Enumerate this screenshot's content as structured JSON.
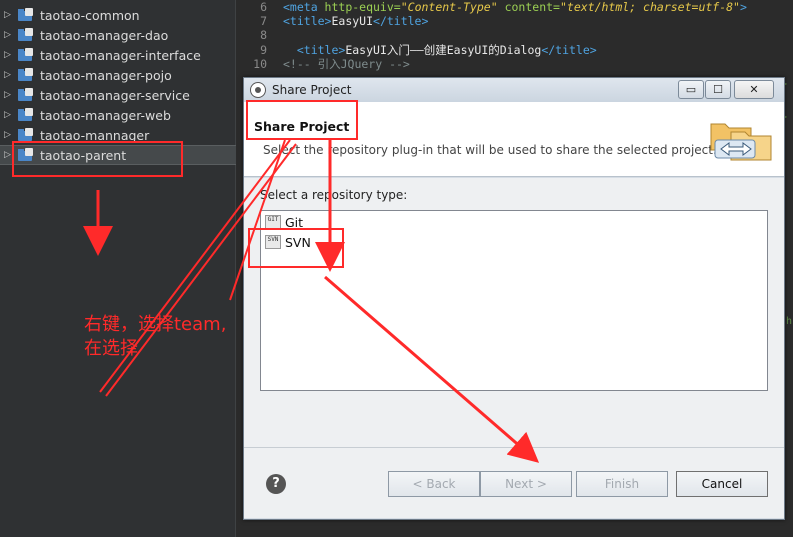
{
  "explorer": {
    "items": [
      {
        "label": "taotao-common",
        "expanded": false
      },
      {
        "label": "taotao-manager-dao",
        "expanded": false
      },
      {
        "label": "taotao-manager-interface",
        "expanded": false
      },
      {
        "label": "taotao-manager-pojo",
        "expanded": false
      },
      {
        "label": "taotao-manager-service",
        "expanded": false
      },
      {
        "label": "taotao-manager-web",
        "expanded": false
      },
      {
        "label": "taotao-mannager",
        "expanded": false
      },
      {
        "label": "taotao-parent",
        "expanded": false,
        "selected": true
      }
    ]
  },
  "editor": {
    "lines": [
      {
        "num": "6",
        "parts": [
          {
            "c": "tag",
            "t": "<meta "
          },
          {
            "c": "attr",
            "t": "http-equiv="
          },
          {
            "c": "str",
            "t": "\"Content-Type\""
          },
          {
            "c": "attr",
            "t": " content="
          },
          {
            "c": "str",
            "t": "\"text/html; charset=utf-8\""
          },
          {
            "c": "tag",
            "t": ">"
          }
        ]
      },
      {
        "num": "7",
        "parts": [
          {
            "c": "tag",
            "t": "<title>"
          },
          {
            "c": "txt",
            "t": "EasyUI"
          },
          {
            "c": "tag",
            "t": "</title>"
          }
        ]
      },
      {
        "num": "8",
        "parts": []
      },
      {
        "num": "9",
        "parts": [
          {
            "c": "txt",
            "t": "  "
          },
          {
            "c": "tag",
            "t": "<title>"
          },
          {
            "c": "txt",
            "t": "EasyUI入门——创建EasyUI的Dialog"
          },
          {
            "c": "tag",
            "t": "</title>"
          }
        ]
      },
      {
        "num": "10",
        "parts": [
          {
            "c": "cmt",
            "t": "<!-- 引入JQuery -->"
          }
        ]
      }
    ]
  },
  "dialog": {
    "title": "Share Project",
    "window_buttons": {
      "minimize": "▭",
      "maximize": "☐",
      "close": "✕"
    },
    "banner_title": "Share Project",
    "banner_description": "Select the repository plug-in that will be used to share the selected project.",
    "repo_label": "Select a repository type:",
    "repositories": [
      {
        "label": "Git",
        "icon": "git-repo-icon"
      },
      {
        "label": "SVN",
        "icon": "svn-repo-icon"
      }
    ],
    "buttons": {
      "help": "?",
      "back": "< Back",
      "next": "Next >",
      "finish": "Finish",
      "cancel": "Cancel"
    }
  },
  "annotation": {
    "line1": "右键，选择team,",
    "line2": "在选择",
    "color": "#ff2a2a"
  }
}
